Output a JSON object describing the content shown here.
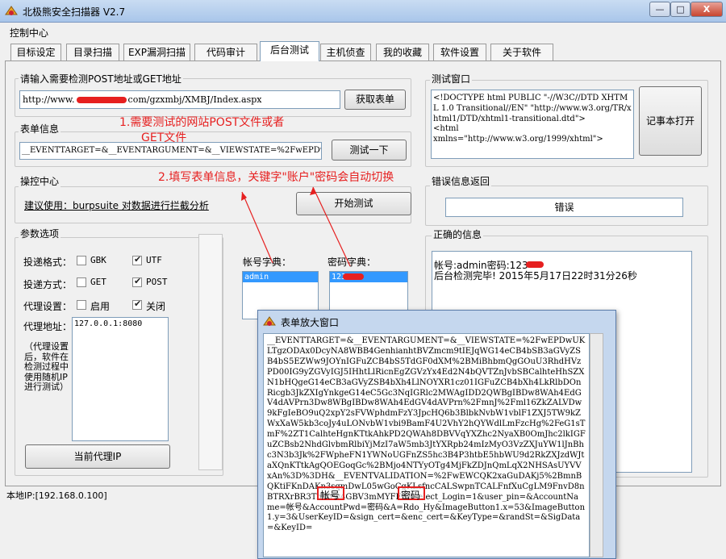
{
  "window": {
    "title": "北极熊安全扫描器 V2.7",
    "controls": {
      "minimize": "—",
      "maximize": "□",
      "close": "X"
    }
  },
  "menu": {
    "label": "控制中心"
  },
  "tabs": [
    {
      "label": "目标设定",
      "active": false
    },
    {
      "label": "目录扫描",
      "active": false
    },
    {
      "label": "EXP漏洞扫描",
      "active": false
    },
    {
      "label": "代码审计",
      "active": false
    },
    {
      "label": "后台测试",
      "active": true
    },
    {
      "label": "主机侦查",
      "active": false
    },
    {
      "label": "我的收藏",
      "active": false
    },
    {
      "label": "软件设置",
      "active": false
    },
    {
      "label": "关于软件",
      "active": false
    }
  ],
  "url_group": {
    "label": "请输入需要检测POST地址或GET地址",
    "url_prefix": "http://www.",
    "url_suffix": "com/gzxmbj/XMBJ/Index.aspx",
    "fetch_button": "获取表单"
  },
  "form_group": {
    "label": "表单信息",
    "value": "__EVENTTARGET=&__EVENTARGUMENT=&__VIEWSTATE=%2FwEPDwUKLTgzODAx",
    "test_button": "测试一下"
  },
  "annotations": {
    "note1_line1": "1.需要测试的网站POST文件或者",
    "note1_line2": "GET文件",
    "note2": "2.填写表单信息，关键字\"账户\"密码会自动切换",
    "box_account": "帐号",
    "box_password": "密码"
  },
  "control_group": {
    "label": "操控中心",
    "advice": "建议使用：burpsuite 对数据进行拦截分析",
    "start_button": "开始测试"
  },
  "params_group": {
    "label": "参数选项",
    "encoding_label": "投递格式：",
    "gbk": "GBK",
    "utf": "UTF",
    "method_label": "投递方式：",
    "get": "GET",
    "post": "POST",
    "proxy_label": "代理设置：",
    "enable": "启用",
    "disable": "关闭",
    "proxy_addr_label": "代理地址：",
    "proxy_addr_value": "127.0.0.1:8080",
    "proxy_note": "（代理设置后，软件在检测过程中使用随机IP进行测试）",
    "current_ip_button": "当前代理IP",
    "checks": {
      "gbk": false,
      "utf": true,
      "get": false,
      "post": true,
      "enable": false,
      "disable": true
    }
  },
  "dict": {
    "account_label": "帐号字典：",
    "account_item": "admin",
    "password_label": "密码字典：",
    "password_item": "123"
  },
  "test_window": {
    "label": "测试窗口",
    "content": "<!DOCTYPE html PUBLIC \"-//W3C//DTD XHTML 1.0 Transitional//EN\" \"http://www.w3.org/TR/xhtml1/DTD/xhtml1-transitional.dtd\">\n<html\nxmlns=\"http://www.w3.org/1999/xhtml\">",
    "notepad_button": "记事本打开"
  },
  "error_group": {
    "label": "错误信息返回",
    "value": "错误"
  },
  "correct_group": {
    "label": "正确的信息",
    "line1": "帐号:admin密码:123",
    "line2": "后台检测完毕! 2015年5月17日22时31分26秒"
  },
  "status": {
    "local_ip": "本地IP:[192.168.0.100]"
  },
  "popup": {
    "title": "表单放大窗口",
    "content": "__EVENTTARGET=&__EVENTARGUMENT=&__VIEWSTATE=%2FwEPDwUKLTgzODAx0DcyNA8WBB4GenhianhtBVZmcm9tIEJqWG14eCB4bSB3aGVyZSB4bS5EZWw9JOYnIGFuZCB4bS5TdGF0dXM%2BMiBhbmQgGOuU3RhdHVzPD00IG9yZGVyIGJ5IHhtLlRicnEgZGVzYx4Ed2N4bQVTZnJvbSBCalhteHhSZXN1bHQgeG14eCB3aGVyZSB4bXh4LlNOYXR1cz01IGFuZCB4bXh4LkRlbDOnRicgb3JkZXIgYnkgeG14eC5Gc3NqIGRlc2MWAgIDD2QWBgIBDw8WAh4EdGV4dAVPrn3Dw8WBgIBDw8WAh4EdGV4dAVPrn%2FmnJ%2Fml16ZkZALVDw9kFgIeBO9uQ2xpY2sFVWphdmFzY3JpcHQ6b3BlbkNvbW1vblF1ZXJ5TW9kZWxXaW5kb3coJy4uLONvbW1vbi9BamF4U2VhY2hQYWdlLmFzcHg%2FeG1sTmF%2ZT1CalhteHgnKTtkAhkPD2QWAh8DBVVqYXZhc2NyaXB0OmJhc2lkIGFuZCBsb2NhdGlvbmRlbiYjMzI7aW5mb3JtYXRpb24mIzMyO3VzZXJuYW1lJnBhc3N3b3Jk%2FWpheFN1YWNoUGFnZS5hc3B4P3htbE5hbWU9d2RkZXJzdWJtaXQnKTtkAgQOEGoqGc%2BMjo4NTYyOTg4MjFkZDJnQmLqX2NHSAsUYVVxAn%3D%3DH&__EVENTVALIDATION=%2FwEWCQK2xaGuDAKj5%2BmnBQKtiFKnDAKn3sqmDwL05wGoCgKLsfncCALSwpnTCALFnfXuCgLM9FnvD8nBTRXrBR3ThWrw4GBV3mMYFFS&select_Login=1&user_pin=&AccountName=帐号&AccountPwd=密码&A=Rdo_Hy&ImageButton1.x=53&ImageButton1.y=3&UserKeyID=&sign_cert=&enc_cert=&KeyType=&randSt=&SigData=&KeyID="
  },
  "colors": {
    "accent_red": "#e62020",
    "selection_blue": "#3399ff",
    "titlebar": "#b9d1ee"
  }
}
